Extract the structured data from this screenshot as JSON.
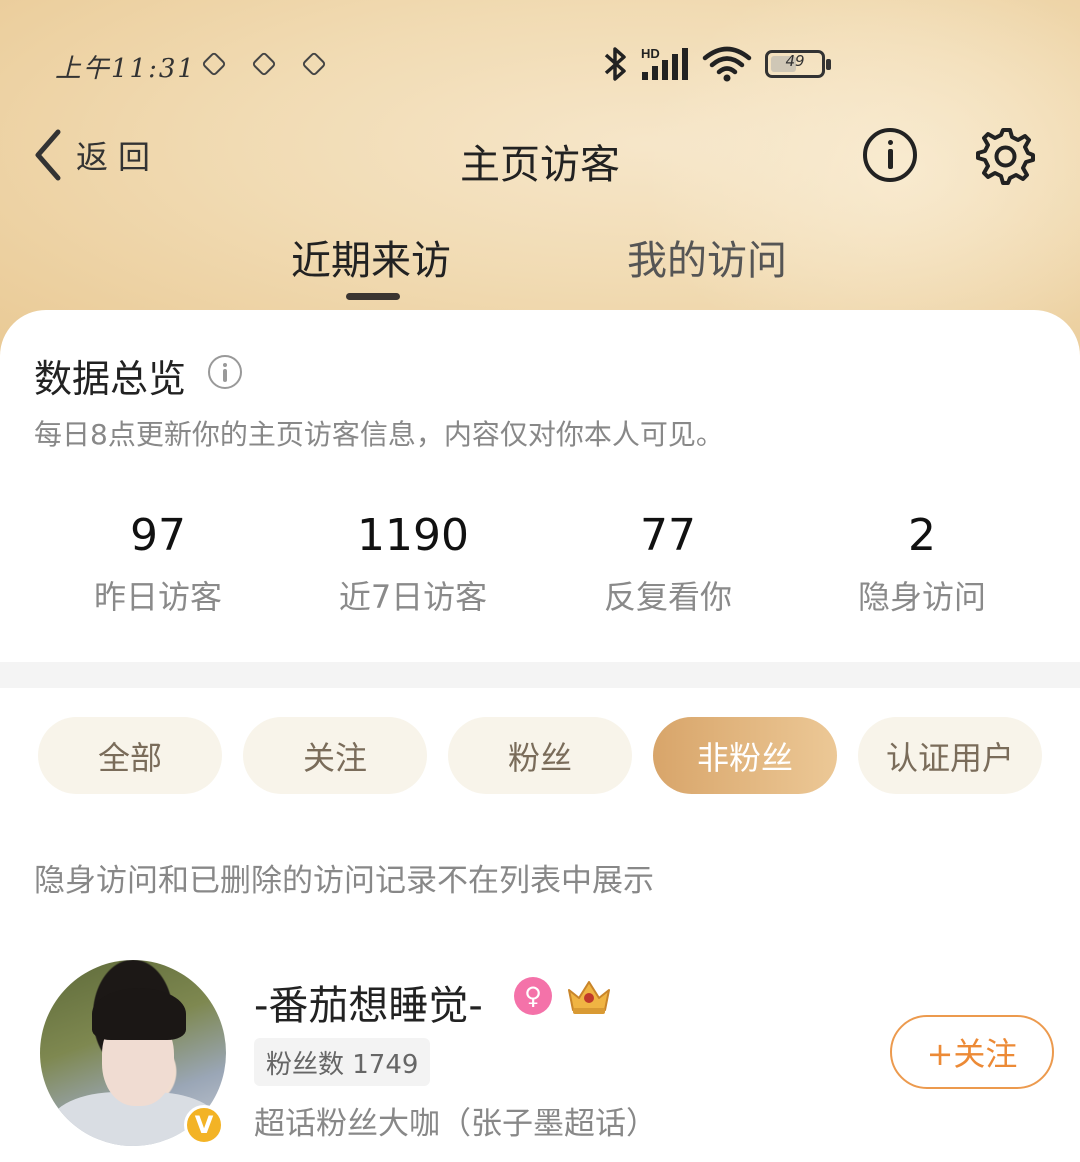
{
  "status_bar": {
    "time": "上午11:31",
    "signal_label": "HD",
    "battery": "49",
    "battery_fraction": 0.49
  },
  "nav": {
    "back_label": "返回",
    "title": "主页访客"
  },
  "tabs": [
    {
      "label": "近期来访",
      "active": true
    },
    {
      "label": "我的访问",
      "active": false
    }
  ],
  "overview": {
    "title": "数据总览",
    "description": "每日8点更新你的主页访客信息，内容仅对你本人可见。",
    "stats": [
      {
        "value": "97",
        "label": "昨日访客"
      },
      {
        "value": "1190",
        "label": "近7日访客"
      },
      {
        "value": "77",
        "label": "反复看你"
      },
      {
        "value": "2",
        "label": "隐身访问"
      }
    ]
  },
  "filters": [
    {
      "label": "全部",
      "active": false
    },
    {
      "label": "关注",
      "active": false
    },
    {
      "label": "粉丝",
      "active": false
    },
    {
      "label": "非粉丝",
      "active": true
    },
    {
      "label": "认证用户",
      "active": false
    }
  ],
  "hint": "隐身访问和已删除的访问记录不在列表中展示",
  "visitors": [
    {
      "name": "-番茄想睡觉-",
      "fans": "粉丝数 1749",
      "desc": "超话粉丝大咖（张子墨超话）",
      "badge": "V",
      "follow_label": "+关注",
      "icons": [
        "female-icon",
        "crown-icon"
      ]
    }
  ],
  "colors": {
    "accent": "#ec8a36",
    "chip_active": "#dfb077",
    "chip_bg": "#f8f4ea",
    "gender": "#f472a9",
    "vbadge": "#f3b325"
  }
}
